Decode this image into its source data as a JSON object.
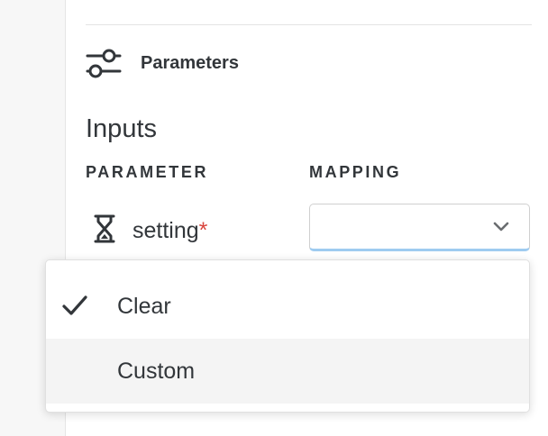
{
  "section": {
    "icon": "sliders-icon",
    "title": "Parameters"
  },
  "inputs": {
    "heading": "Inputs",
    "columns": {
      "parameter": "PARAMETER",
      "mapping": "MAPPING"
    },
    "rows": [
      {
        "icon": "hourglass-icon",
        "name": "setting",
        "required_marker": "*",
        "mapping_value": ""
      }
    ]
  },
  "dropdown": {
    "options": [
      {
        "label": "Clear",
        "selected": true,
        "hovered": false
      },
      {
        "label": "Custom",
        "selected": false,
        "hovered": true
      }
    ],
    "chevron_icon": "chevron-down-icon",
    "check_icon": "checkmark-icon"
  },
  "colors": {
    "text": "#32363a",
    "required": "#d9453d",
    "focus_underline": "#9ecbf0",
    "hover_bg": "#f4f4f4"
  }
}
